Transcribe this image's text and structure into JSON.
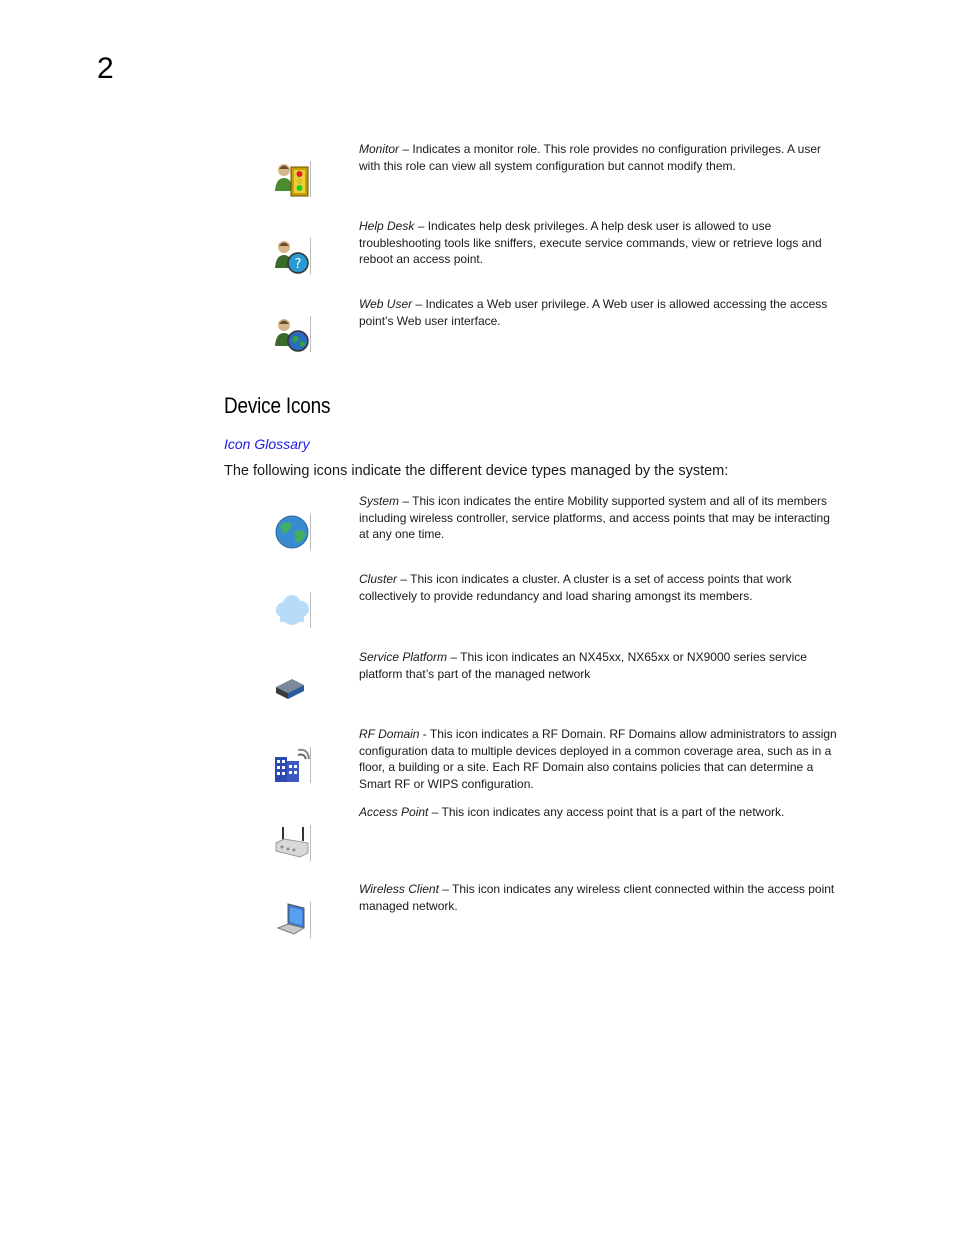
{
  "page": {
    "chapter_number": "2"
  },
  "role_icons": [
    {
      "name": "Monitor",
      "icon": "monitor-role-icon",
      "description": " – Indicates a monitor role. This role provides no configuration privileges. A user with this role can view all system configuration but cannot modify them."
    },
    {
      "name": "Help Desk",
      "icon": "help-desk-role-icon",
      "description": " – Indicates help desk privileges. A help desk user is allowed to use troubleshooting tools like sniffers, execute service commands, view or retrieve logs and reboot an access point."
    },
    {
      "name": "Web User",
      "icon": "web-user-role-icon",
      "description": " – Indicates a Web user privilege. A Web user is allowed accessing the access point’s Web user interface."
    }
  ],
  "device_section": {
    "heading": "Device Icons",
    "link": "Icon Glossary",
    "intro": "The following icons indicate the different device types managed by the system:",
    "items": [
      {
        "name": "System",
        "icon": "system-globe-icon",
        "description": " – This icon indicates the entire Mobility supported system and all of its members including wireless controller, service platforms, and access points that may be interacting at any one time."
      },
      {
        "name": "Cluster",
        "icon": "cluster-cloud-icon",
        "description": " – This icon indicates a cluster. A cluster is a set of access points that work collectively to provide redundancy and load sharing amongst its members."
      },
      {
        "name": "Service Platform",
        "icon": "service-platform-icon",
        "description": " – This icon indicates an NX45xx, NX65xx or NX9000 series service platform that’s part of the managed network"
      },
      {
        "name": "RF Domain",
        "icon": "rf-domain-building-icon",
        "description": " - This icon indicates a RF Domain. RF Domains allow administrators to assign configuration data to multiple devices deployed in a common coverage area, such as in a floor, a building or a site. Each RF Domain also contains policies that can determine a Smart RF or WIPS configuration."
      },
      {
        "name": "Access Point",
        "icon": "access-point-icon",
        "description": " – This icon indicates any access point that is a part of the network."
      },
      {
        "name": "Wireless Client",
        "icon": "wireless-client-laptop-icon",
        "description": " – This icon indicates any wireless client connected within the access point managed network."
      }
    ]
  }
}
